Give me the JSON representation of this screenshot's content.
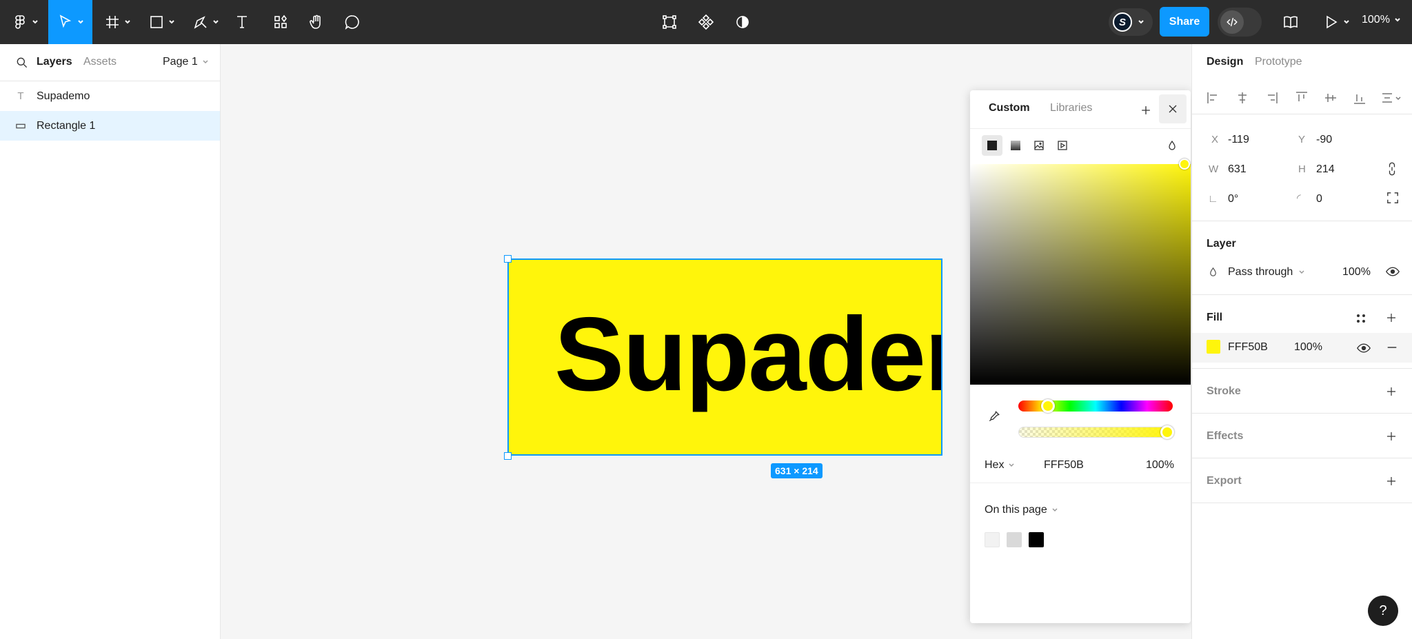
{
  "toolbar": {
    "share_label": "Share",
    "avatar_initial": "S",
    "zoom": "100%"
  },
  "left_panel": {
    "tabs": {
      "layers": "Layers",
      "assets": "Assets"
    },
    "page": "Page 1",
    "layers": [
      {
        "name": "Supademo",
        "type": "text-icon"
      },
      {
        "name": "Rectangle 1",
        "type": "rectangle-icon"
      }
    ]
  },
  "canvas": {
    "text": "Supademo",
    "size_badge": "631 × 214",
    "fill_color": "#fff50b"
  },
  "picker": {
    "tabs": {
      "custom": "Custom",
      "libraries": "Libraries"
    },
    "mode": "Hex",
    "hex": "FFF50B",
    "opacity": "100%",
    "on_page_label": "On this page",
    "swatches": [
      "#f2f2f2",
      "#d9d9d9",
      "#000000"
    ]
  },
  "right_panel": {
    "tabs": {
      "design": "Design",
      "prototype": "Prototype"
    },
    "x_label": "X",
    "x": "-119",
    "y_label": "Y",
    "y": "-90",
    "w_label": "W",
    "w": "631",
    "h_label": "H",
    "h": "214",
    "rotation": "0°",
    "radius": "0",
    "layer_title": "Layer",
    "blend": "Pass through",
    "layer_opacity": "100%",
    "fill_title": "Fill",
    "fill_hex": "FFF50B",
    "fill_opacity": "100%",
    "stroke_title": "Stroke",
    "effects_title": "Effects",
    "export_title": "Export"
  },
  "help_label": "?"
}
